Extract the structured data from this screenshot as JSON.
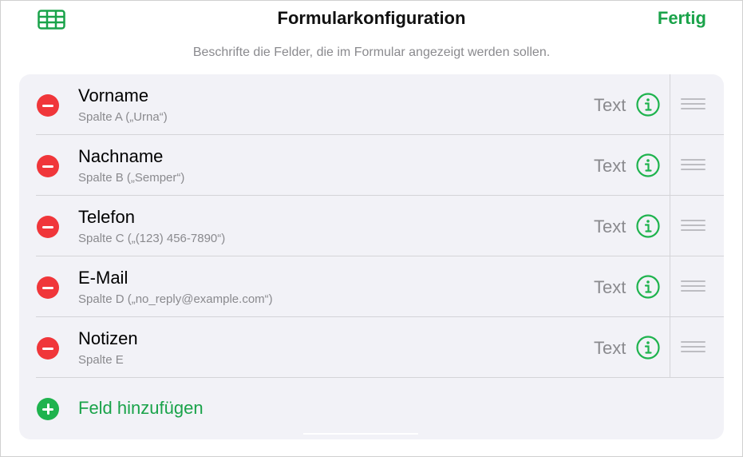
{
  "header": {
    "title": "Formularkonfiguration",
    "done_label": "Fertig",
    "table_icon": "table-icon",
    "accent_color": "#1aa34a"
  },
  "subtitle": "Beschrifte die Felder, die im Formular angezeigt werden sollen.",
  "fields": [
    {
      "name": "Vorname",
      "column": "Spalte A („Urna“)",
      "type": "Text"
    },
    {
      "name": "Nachname",
      "column": "Spalte B („Semper“)",
      "type": "Text"
    },
    {
      "name": "Telefon",
      "column": "Spalte C („(123) 456-7890“)",
      "type": "Text"
    },
    {
      "name": "E-Mail",
      "column": "Spalte D („no_reply@example.com“)",
      "type": "Text"
    },
    {
      "name": "Notizen",
      "column": "Spalte E",
      "type": "Text"
    }
  ],
  "add_field_label": "Feld hinzufügen",
  "colors": {
    "remove": "#f0363a",
    "add": "#1fb34e",
    "secondary_text": "#8a8a8e",
    "card_background": "#f2f2f7"
  }
}
